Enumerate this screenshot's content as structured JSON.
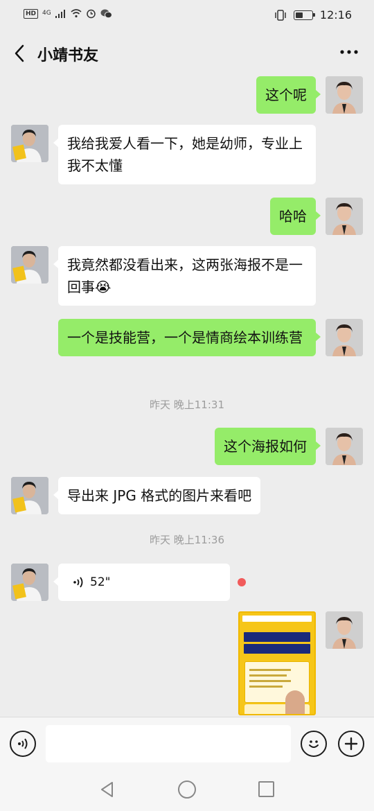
{
  "status_bar": {
    "hd": "HD",
    "network": "4G",
    "time": "12:16",
    "battery_level": 0.45
  },
  "header": {
    "title": "小靖书友",
    "more_icon": "more-icon"
  },
  "colors": {
    "my_bubble": "#95ec69",
    "other_bubble": "#ffffff",
    "background": "#ededed",
    "unread_dot": "#f15b5b"
  },
  "messages": {
    "m1": "这个呢",
    "m2": "我给我爱人看一下，她是幼师，专业上我不太懂",
    "m3": "哈哈",
    "m4": "我竟然都没看出来，这两张海报不是一回事",
    "m4_emoji": "😭",
    "m5": "一个是技能营，一个是情商绘本训练营",
    "t1": "昨天 晚上11:31",
    "m6": "这个海报如何",
    "m7": "导出来 JPG 格式的图片来看吧",
    "t2": "昨天 晚上11:36",
    "voice_duration": "52\""
  },
  "input": {
    "voice_icon": "voice-icon",
    "emoji_icon": "emoji-icon",
    "plus_icon": "plus-icon"
  }
}
